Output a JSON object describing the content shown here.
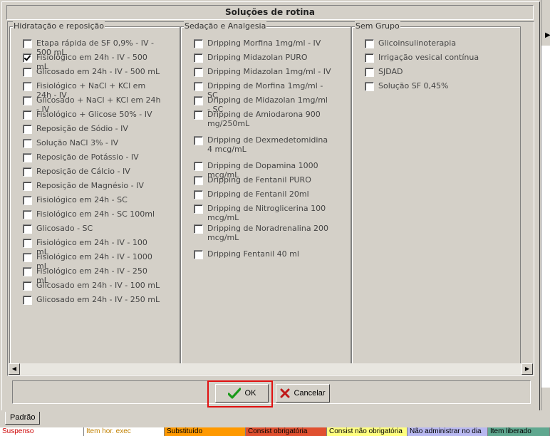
{
  "dialog": {
    "title": "Soluções de rotina"
  },
  "groups": [
    {
      "title": "Hidratação e reposição",
      "items": [
        {
          "label": "Etapa rápida de SF 0,9% - IV - 500 mL",
          "checked": false
        },
        {
          "label": "Fisiológico em 24h - IV - 500 mL",
          "checked": true
        },
        {
          "label": "Glicosado em 24h - IV - 500 mL",
          "checked": false
        },
        {
          "label": "Fisiológico + NaCl + KCl em 24h - IV",
          "checked": false
        },
        {
          "label": "Glicosado + NaCl + KCl em 24h - IV",
          "checked": false
        },
        {
          "label": "Fisiológico + Glicose 50% - IV",
          "checked": false
        },
        {
          "label": "Reposição de Sódio - IV",
          "checked": false
        },
        {
          "label": "Solução NaCl 3% - IV",
          "checked": false
        },
        {
          "label": "Reposição de Potássio - IV",
          "checked": false
        },
        {
          "label": "Reposição de Cálcio - IV",
          "checked": false
        },
        {
          "label": "Reposição de Magnésio - IV",
          "checked": false
        },
        {
          "label": "Fisiológico em 24h - SC",
          "checked": false
        },
        {
          "label": "Fisiológico em 24h - SC 100ml",
          "checked": false
        },
        {
          "label": "Glicosado - SC",
          "checked": false
        },
        {
          "label": "Fisiológico em 24h - IV - 100 mL",
          "checked": false
        },
        {
          "label": "Fisiológico em 24h - IV - 1000 mL",
          "checked": false
        },
        {
          "label": "Fisiológico em 24h - IV - 250 mL",
          "checked": false
        },
        {
          "label": "Glicosado em 24h - IV - 100 mL",
          "checked": false
        },
        {
          "label": "Glicosado em 24h - IV - 250 mL",
          "checked": false
        }
      ]
    },
    {
      "title": "Sedação e Analgesia",
      "items": [
        {
          "label": "Dripping Morfina 1mg/ml - IV",
          "checked": false
        },
        {
          "label": "Dripping Midazolan PURO",
          "checked": false
        },
        {
          "label": "Dripping Midazolan 1mg/ml - IV",
          "checked": false
        },
        {
          "label": "Dripping de Morfina 1mg/ml - SC",
          "checked": false
        },
        {
          "label": "Dripping de Midazolan 1mg/ml - SC",
          "checked": false
        },
        {
          "label": "Dripping de Amiodarona 900 mg/250mL",
          "checked": false
        },
        {
          "label": "Dripping de Dexmedetomidina 4 mcg/mL",
          "checked": false
        },
        {
          "label": "Dripping de Dopamina 1000 mcg/mL",
          "checked": false
        },
        {
          "label": "Dripping de Fentanil PURO",
          "checked": false
        },
        {
          "label": "Dripping de Fentanil 20ml",
          "checked": false
        },
        {
          "label": "Dripping de Nitroglicerina 100 mcg/mL",
          "checked": false
        },
        {
          "label": "Dripping de Noradrenalina 200 mcg/mL",
          "checked": false
        },
        {
          "label": "Dripping Fentanil 40 ml",
          "checked": false
        }
      ]
    },
    {
      "title": "Sem Grupo",
      "items": [
        {
          "label": "Glicoinsulinoterapia",
          "checked": false
        },
        {
          "label": "Irrigação vesical contínua",
          "checked": false
        },
        {
          "label": "SJDAD",
          "checked": false
        },
        {
          "label": "Solução SF 0,45%",
          "checked": false
        }
      ]
    }
  ],
  "buttons": {
    "ok_label": "OK",
    "cancel_label": "Cancelar"
  },
  "bottom_tab": "Padrão",
  "legend": [
    {
      "label": "Suspenso",
      "color": "#ffffff",
      "text_color": "#cc0000"
    },
    {
      "label": "Item hor. exec",
      "color": "#ffffff",
      "text_color": "#c08000"
    },
    {
      "label": "Substituído",
      "color": "#ff9900",
      "text_color": "#000000"
    },
    {
      "label": "Consist obrigatória",
      "color": "#e05030",
      "text_color": "#000000"
    },
    {
      "label": "Consist não obrigatória",
      "color": "#ffff80",
      "text_color": "#000000"
    },
    {
      "label": "Não administrar no dia",
      "color": "#b8b8f0",
      "text_color": "#000000"
    },
    {
      "label": "Item liberado",
      "color": "#60a890",
      "text_color": "#000000"
    }
  ]
}
